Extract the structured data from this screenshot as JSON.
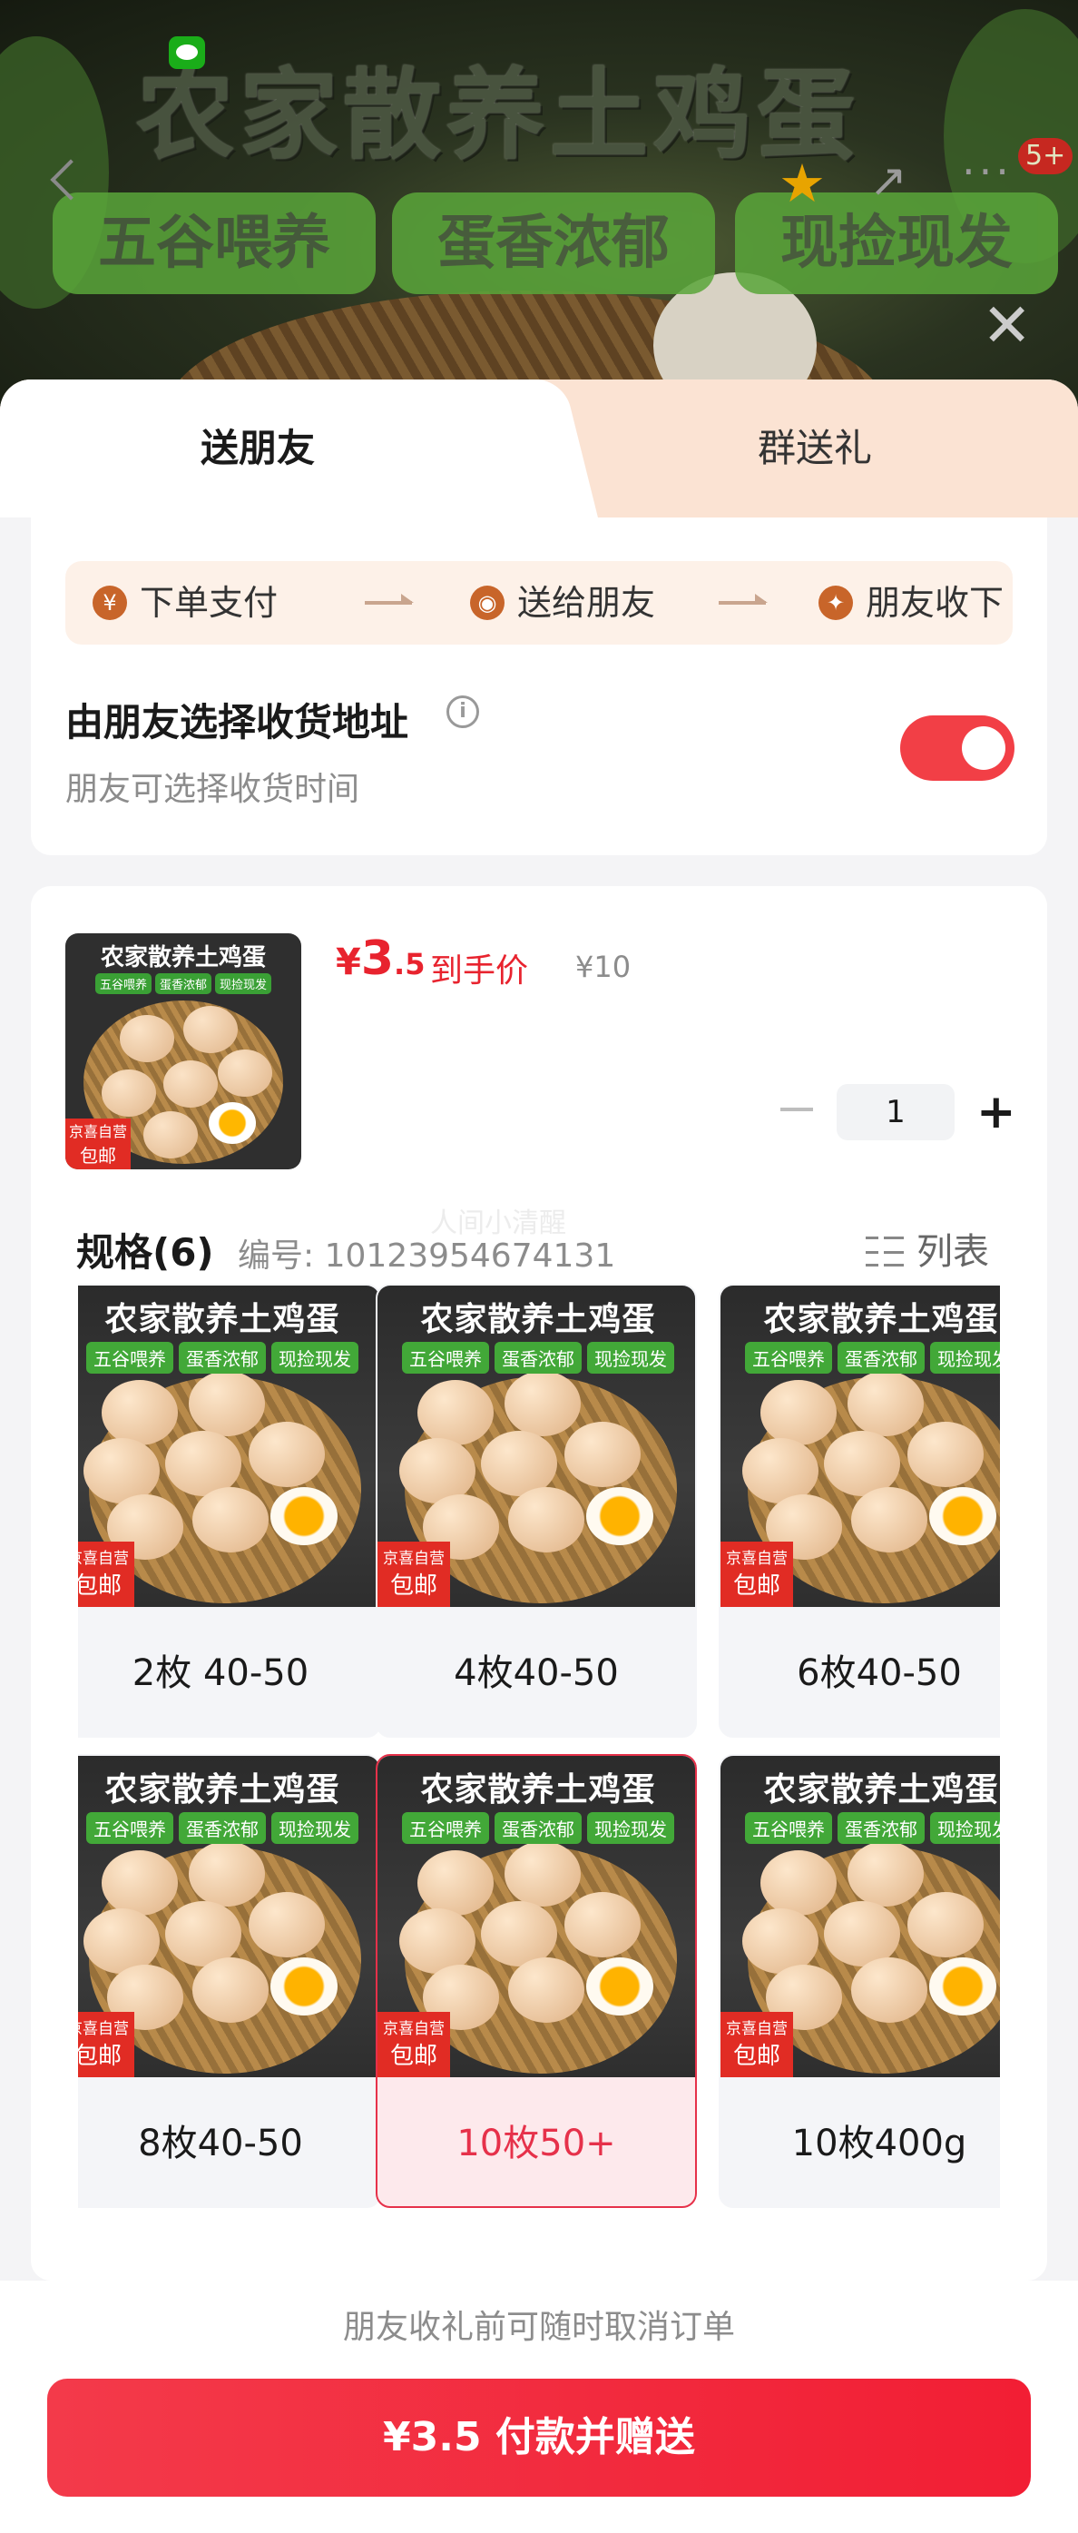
{
  "banner": {
    "title": "农家散养土鸡蛋",
    "tags": [
      "五谷喂养",
      "蛋香浓郁",
      "现捡现发"
    ],
    "notification_badge": "5+"
  },
  "tabs": {
    "send_friend": "送朋友",
    "group_gift": "群送礼"
  },
  "flow": {
    "steps": [
      "下单支付",
      "送给朋友",
      "朋友收下"
    ],
    "icons": [
      "yuan-icon",
      "wechat-icon",
      "gift-icon"
    ]
  },
  "address": {
    "title": "由朋友选择收货地址",
    "subtitle": "朋友可选择收货时间",
    "toggle_on": true
  },
  "product": {
    "thumb_title": "农家散养土鸡蛋",
    "thumb_tags": [
      "五谷喂养",
      "蛋香浓郁",
      "现捡现发"
    ],
    "badge_top": "京喜自营",
    "badge_bottom": "包邮",
    "currency": "¥",
    "price_int": "3",
    "price_dec": ".5",
    "price_label": "到手价",
    "original_price": "¥10",
    "quantity": "1"
  },
  "spec": {
    "title": "规格(6)",
    "number_label": "编号: 10123954674131",
    "watermark": "人间小清醒",
    "list_label": "列表",
    "variant_image_title": "农家散养土鸡蛋",
    "variant_image_tags": [
      "五谷喂养",
      "蛋香浓郁",
      "现捡现发"
    ],
    "variant_badge_top": "京喜自营",
    "variant_badge_bottom": "包邮",
    "variants": [
      {
        "label": "2枚 40-50",
        "selected": false
      },
      {
        "label": "4枚40-50",
        "selected": false
      },
      {
        "label": "6枚40-50",
        "selected": false
      },
      {
        "label": "8枚40-50",
        "selected": false
      },
      {
        "label": "10枚50+",
        "selected": true
      },
      {
        "label": "10枚400g",
        "selected": false
      }
    ]
  },
  "footer": {
    "note": "朋友收礼前可随时取消订单",
    "pay_button": "¥3.5 付款并赠送"
  },
  "colors": {
    "accent": "#f23f46",
    "price_red": "#e8232e",
    "tab_bg": "#fbe3d3",
    "flow_bg": "#fdf1e8"
  }
}
